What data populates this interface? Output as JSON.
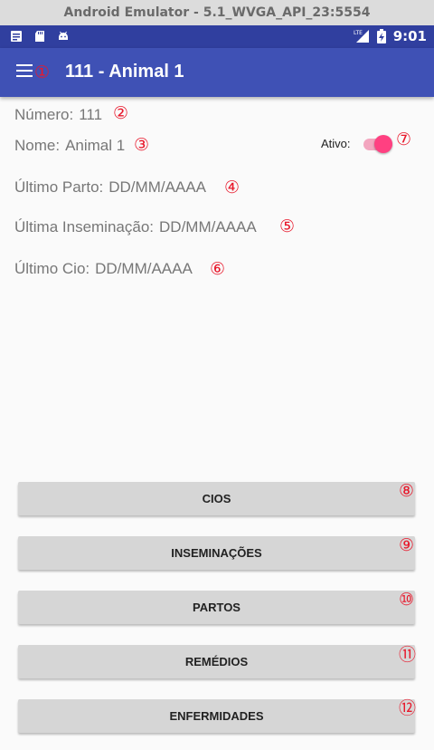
{
  "emulator": {
    "title": "Android Emulator - 5.1_WVGA_API_23:5554"
  },
  "statusbar": {
    "icons_left": [
      "news-icon",
      "sd-card-icon",
      "android-icon"
    ],
    "network": "LTE",
    "time": "9:01"
  },
  "toolbar": {
    "menu_icon": "hamburger-menu-icon",
    "title": "111 - Animal 1"
  },
  "fields": {
    "numero": {
      "label": "Número:",
      "value": "111"
    },
    "nome": {
      "label": "Nome:",
      "value": "Animal 1"
    },
    "ultimo_parto": {
      "label": "Último Parto:",
      "value": "DD/MM/AAAA"
    },
    "ultima_inseminacao": {
      "label": "Última Inseminação:",
      "value": "DD/MM/AAAA"
    },
    "ultimo_cio": {
      "label": "Último Cio:",
      "value": "DD/MM/AAAA"
    }
  },
  "ativo": {
    "label": "Ativo:",
    "checked": true
  },
  "buttons": {
    "cios": "CIOS",
    "inseminacoes": "INSEMINAÇÕES",
    "partos": "PARTOS",
    "remedios": "REMÉDIOS",
    "enfermidades": "ENFERMIDADES"
  },
  "annotations": [
    "①",
    "②",
    "③",
    "④",
    "⑤",
    "⑥",
    "⑦",
    "⑧",
    "⑨",
    "⑩",
    "⑪",
    "⑫"
  ],
  "colors": {
    "statusbar": "#303f9f",
    "toolbar": "#3f51b5",
    "accent": "#ff4081",
    "annotation": "#e8192c"
  }
}
